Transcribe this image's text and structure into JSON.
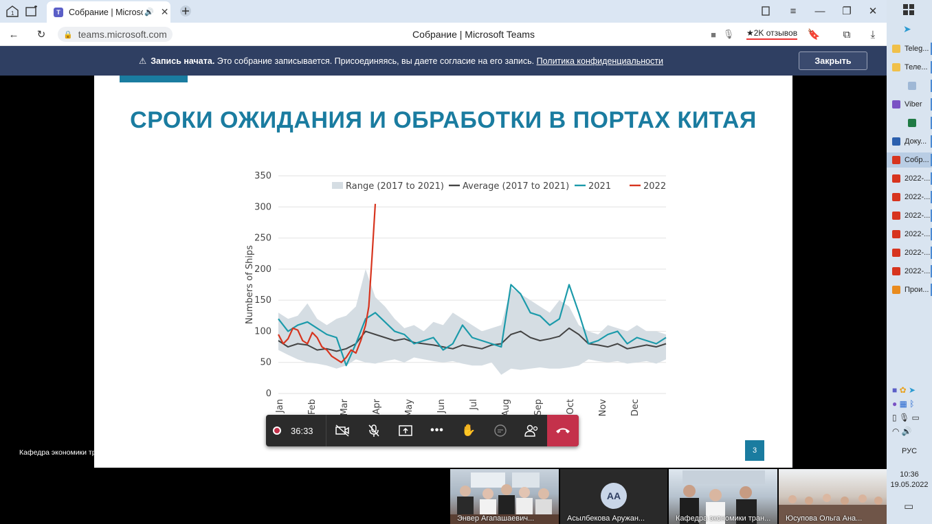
{
  "browser": {
    "tab_title": "Собрание | Microsoft Teams",
    "url": "teams.microsoft.com",
    "page_title": "Собрание | Microsoft Teams",
    "reviews": "★2K отзывов"
  },
  "banner": {
    "bold": "Запись начата.",
    "text": " Это собрание записывается. Присоединяясь, вы даете согласие на его запись. ",
    "link": "Политика конфиденциальности",
    "close": "Закрыть"
  },
  "slide": {
    "title": "СРОКИ ОЖИДАНИЯ И ОБРАБОТКИ В ПОРТАХ КИТАЯ",
    "number": "3",
    "footer": "Кафедра экономики транспорта и финансов"
  },
  "chart_data": {
    "type": "line",
    "ylabel": "Numbers of Ships",
    "ylim": [
      0,
      350
    ],
    "yticks": [
      0,
      50,
      100,
      150,
      200,
      250,
      300,
      350
    ],
    "xticks": [
      "Jan",
      "Feb",
      "Mar",
      "Apr",
      "May",
      "Jun",
      "Jul",
      "Aug",
      "Sep",
      "Oct",
      "Nov",
      "Dec"
    ],
    "x_range": [
      0,
      12
    ],
    "legend_position": "top",
    "colors": {
      "range": "#d5dde3",
      "average": "#444444",
      "y2021": "#1b9aaa",
      "y2022": "#d7341e"
    },
    "series": [
      {
        "name": "Range (2017 to 2021)",
        "kind": "band",
        "x": [
          0,
          0.3,
          0.6,
          0.9,
          1.2,
          1.5,
          1.8,
          2.1,
          2.4,
          2.7,
          3.0,
          3.3,
          3.6,
          3.9,
          4.2,
          4.5,
          4.8,
          5.1,
          5.4,
          5.7,
          6.0,
          6.3,
          6.6,
          6.9,
          7.2,
          7.5,
          7.8,
          8.1,
          8.4,
          8.7,
          9.0,
          9.3,
          9.6,
          9.9,
          10.2,
          10.5,
          10.8,
          11.1,
          11.4,
          11.7,
          12.0
        ],
        "low": [
          70,
          62,
          55,
          50,
          48,
          45,
          40,
          45,
          55,
          50,
          48,
          52,
          55,
          50,
          58,
          55,
          52,
          50,
          52,
          48,
          45,
          45,
          50,
          30,
          40,
          38,
          40,
          42,
          40,
          40,
          42,
          45,
          55,
          52,
          50,
          52,
          48,
          50,
          52,
          48,
          55
        ],
        "high": [
          130,
          120,
          125,
          145,
          120,
          110,
          120,
          125,
          140,
          200,
          155,
          140,
          120,
          105,
          110,
          100,
          115,
          110,
          130,
          120,
          110,
          100,
          105,
          110,
          170,
          160,
          150,
          140,
          130,
          150,
          140,
          110,
          100,
          95,
          110,
          105,
          100,
          110,
          100,
          100,
          95
        ]
      },
      {
        "name": "Average (2017 to 2021)",
        "kind": "line",
        "x": [
          0,
          0.3,
          0.6,
          0.9,
          1.2,
          1.5,
          1.8,
          2.1,
          2.4,
          2.7,
          3.0,
          3.3,
          3.6,
          3.9,
          4.2,
          4.5,
          4.8,
          5.1,
          5.4,
          5.7,
          6.0,
          6.3,
          6.6,
          6.9,
          7.2,
          7.5,
          7.8,
          8.1,
          8.4,
          8.7,
          9.0,
          9.3,
          9.6,
          9.9,
          10.2,
          10.5,
          10.8,
          11.1,
          11.4,
          11.7,
          12.0
        ],
        "y": [
          85,
          75,
          80,
          78,
          70,
          72,
          68,
          72,
          80,
          100,
          95,
          90,
          85,
          88,
          82,
          80,
          78,
          75,
          72,
          78,
          75,
          72,
          78,
          80,
          95,
          100,
          90,
          85,
          88,
          92,
          105,
          95,
          80,
          78,
          75,
          80,
          72,
          75,
          78,
          75,
          80
        ]
      },
      {
        "name": "2021",
        "kind": "line",
        "x": [
          0,
          0.3,
          0.6,
          0.9,
          1.2,
          1.5,
          1.8,
          2.1,
          2.4,
          2.7,
          3.0,
          3.3,
          3.6,
          3.9,
          4.2,
          4.5,
          4.8,
          5.1,
          5.4,
          5.7,
          6.0,
          6.3,
          6.6,
          6.9,
          7.2,
          7.5,
          7.8,
          8.1,
          8.4,
          8.7,
          9.0,
          9.3,
          9.6,
          9.9,
          10.2,
          10.5,
          10.8,
          11.1,
          11.4,
          11.7,
          12.0
        ],
        "y": [
          120,
          100,
          110,
          115,
          105,
          95,
          90,
          45,
          80,
          120,
          130,
          115,
          100,
          95,
          80,
          85,
          90,
          70,
          80,
          110,
          90,
          85,
          80,
          75,
          175,
          160,
          130,
          125,
          110,
          120,
          175,
          130,
          80,
          85,
          95,
          100,
          80,
          90,
          85,
          80,
          90
        ]
      },
      {
        "name": "2022",
        "kind": "line",
        "x": [
          0,
          0.15,
          0.3,
          0.45,
          0.6,
          0.75,
          0.9,
          1.05,
          1.2,
          1.35,
          1.5,
          1.65,
          1.8,
          1.95,
          2.1,
          2.25,
          2.4,
          2.55,
          2.7,
          2.8,
          2.9,
          3.0
        ],
        "y": [
          95,
          80,
          88,
          105,
          102,
          85,
          80,
          98,
          90,
          75,
          70,
          60,
          55,
          50,
          58,
          70,
          65,
          85,
          110,
          140,
          220,
          305
        ]
      }
    ]
  },
  "meeting": {
    "timer": "36:33",
    "participants": [
      {
        "name": "Энвер Агапашаевич..."
      },
      {
        "name": "Асылбекова Аружан...",
        "initials": "AA"
      },
      {
        "name": "Кафедра экономики тран..."
      },
      {
        "name": "Юсупова Ольга Ана..."
      }
    ]
  },
  "taskbar": {
    "items": [
      "Teleg...",
      "Теле...",
      "",
      "Viber",
      "",
      "Доку...",
      "Собр...",
      "2022-...",
      "2022-...",
      "2022-...",
      "2022-...",
      "2022-...",
      "2022-...",
      "Прои..."
    ],
    "lang": "РУС",
    "time": "10:36",
    "date": "19.05.2022"
  }
}
